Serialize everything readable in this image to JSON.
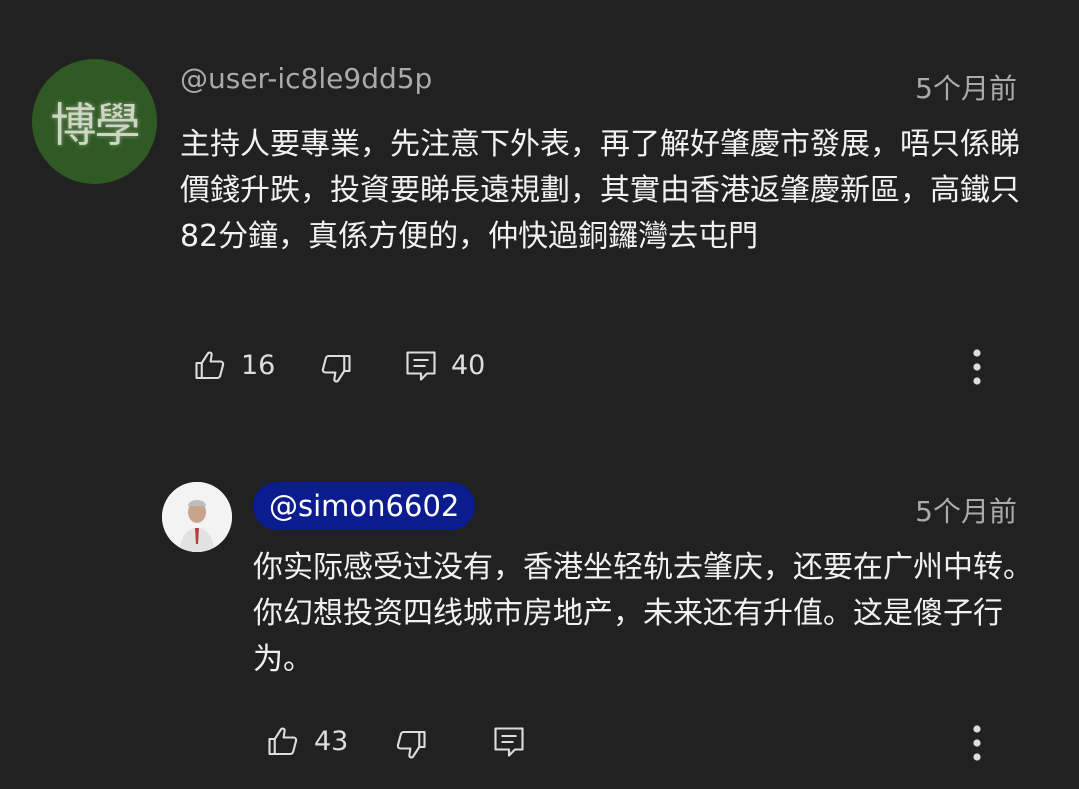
{
  "comments": [
    {
      "avatar_text": "博學",
      "avatar_color": "#2f5a24",
      "handle": "@user-ic8le9dd5p",
      "time": "5个月前",
      "body": "主持人要專業，先注意下外表，再了解好肇慶市發展，唔只係睇價錢升跌，投資要睇長遠規劃，其實由香港返肇慶新區，高鐵只82分鐘，真係方便的，仲快過銅鑼灣去屯門",
      "likes": "16",
      "replies": "40"
    },
    {
      "handle": "@simon6602",
      "handle_highlight_color": "#0b1d8e",
      "time": "5个月前",
      "body": "你实际感受过没有，香港坐轻轨去肇庆，还要在广州中转。你幻想投资四线城市房地产，未来还有升值。这是傻子行为。",
      "likes": "43"
    }
  ],
  "icons": {
    "like": "thumbs-up-icon",
    "dislike": "thumbs-down-icon",
    "reply": "reply-icon",
    "more": "more-vertical-icon"
  }
}
